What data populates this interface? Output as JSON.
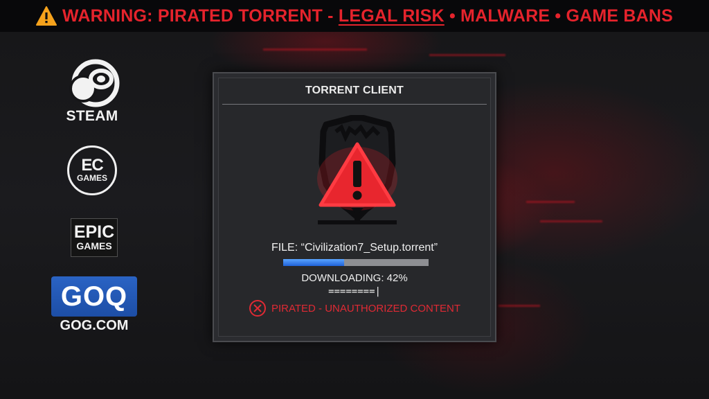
{
  "warning_banner": {
    "prefix": "WARNING: PIRATED TORRENT - ",
    "legal": "LEGAL RISK",
    "rest": " • MALWARE • GAME BANS",
    "icon": "warning-triangle-icon",
    "color": "#e5232c"
  },
  "launchers": {
    "steam": {
      "label": "STEAM",
      "icon": "steam-logo-icon"
    },
    "ea": {
      "main": "EC",
      "sub": "GAMES",
      "icon": "ea-games-logo-icon"
    },
    "epic": {
      "main": "EPIC",
      "sub": "GAMES",
      "icon": "epic-games-logo-icon"
    },
    "gog": {
      "box_text": "GOQ",
      "label": "GOG.COM",
      "icon": "gog-logo-icon",
      "color": "#2a63c4"
    }
  },
  "torrent_client": {
    "title": "TORRENT CLIENT",
    "alert_icon": "shield-alert-download-icon",
    "file_line": "FILE:  “Civilization7_Setup.torrent”",
    "progress": 0.42,
    "status": "DOWNLOADING: 42%",
    "ascii_progress": "========|",
    "pirated_label": "PIRATED - UNAUTHORIZED CONTENT",
    "pirated_icon": "x-circle-icon",
    "alert_color": "#e02a34"
  }
}
